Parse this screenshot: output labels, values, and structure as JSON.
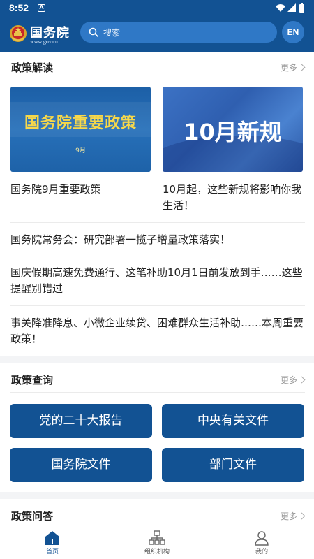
{
  "status_bar": {
    "time": "8:52",
    "notification_icon": "A"
  },
  "header": {
    "title": "国务院",
    "subtitle": "www.gov.cn",
    "search_placeholder": "搜索",
    "lang_button": "EN"
  },
  "section_interpretation": {
    "title": "政策解读",
    "more": "更多",
    "cards": [
      {
        "image_title": "国务院重要政策",
        "image_subtitle": "9月",
        "caption": "国务院9月重要政策"
      },
      {
        "image_title": "10月新规",
        "caption": "10月起，这些新规将影响你我生活！"
      }
    ],
    "news": [
      "国务院常务会：研究部署一揽子增量政策落实！",
      "国庆假期高速免费通行、这笔补助10月1日前发放到手……这些提醒别错过",
      "事关降准降息、小微企业续贷、困难群众生活补助……本周重要政策！"
    ]
  },
  "section_query": {
    "title": "政策查询",
    "more": "更多",
    "buttons": [
      "党的二十大报告",
      "中央有关文件",
      "国务院文件",
      "部门文件"
    ]
  },
  "section_qa": {
    "title": "政策问答",
    "more": "更多"
  },
  "bottom_nav": {
    "items": [
      {
        "label": "首页",
        "icon": "home-icon",
        "active": true
      },
      {
        "label": "组织机构",
        "icon": "org-chart-icon",
        "active": false
      },
      {
        "label": "我的",
        "icon": "profile-icon",
        "active": false
      }
    ]
  },
  "colors": {
    "primary": "#125293",
    "search_bg": "#2f78c6",
    "gold_text": "#f7d84a"
  }
}
